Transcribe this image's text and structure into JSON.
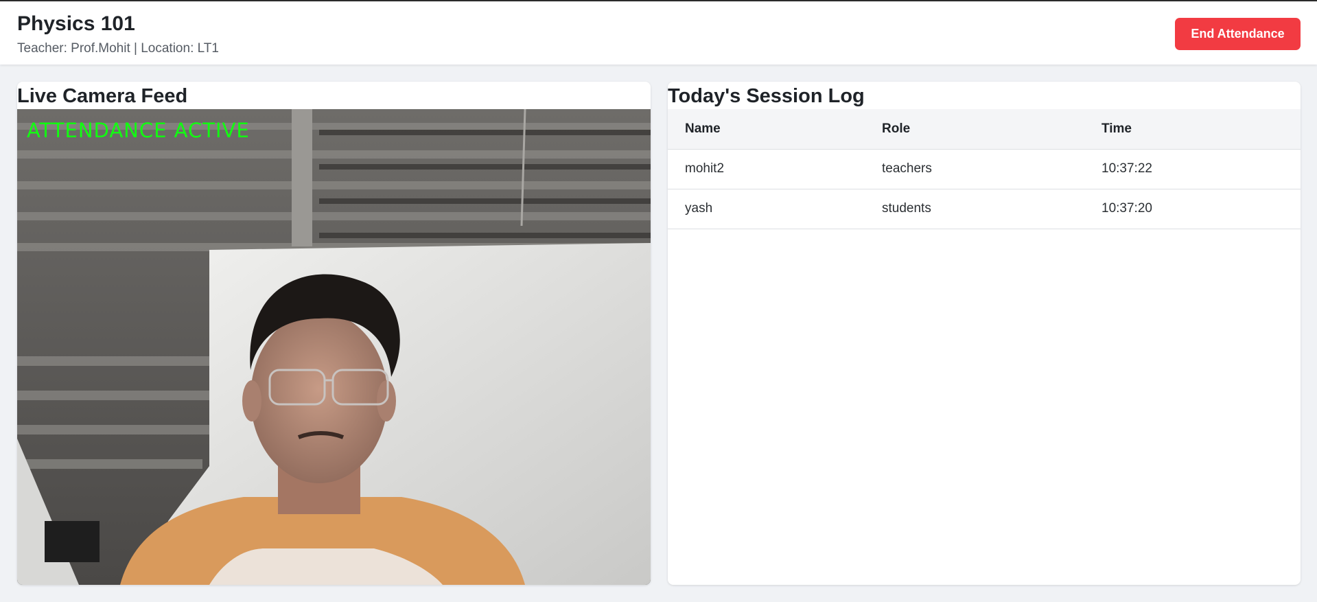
{
  "header": {
    "title": "Physics 101",
    "subtitle": "Teacher: Prof.Mohit | Location: LT1",
    "end_button_label": "End Attendance"
  },
  "camera": {
    "title": "Live Camera Feed",
    "overlay_text": "ATTENDANCE ACTIVE"
  },
  "session_log": {
    "title": "Today's Session Log",
    "columns": [
      "Name",
      "Role",
      "Time"
    ],
    "rows": [
      {
        "name": "mohit2",
        "role": "teachers",
        "time": "10:37:22"
      },
      {
        "name": "yash",
        "role": "students",
        "time": "10:37:20"
      }
    ]
  },
  "colors": {
    "accent_button": "#f23b42",
    "overlay_text": "#11ff11"
  }
}
